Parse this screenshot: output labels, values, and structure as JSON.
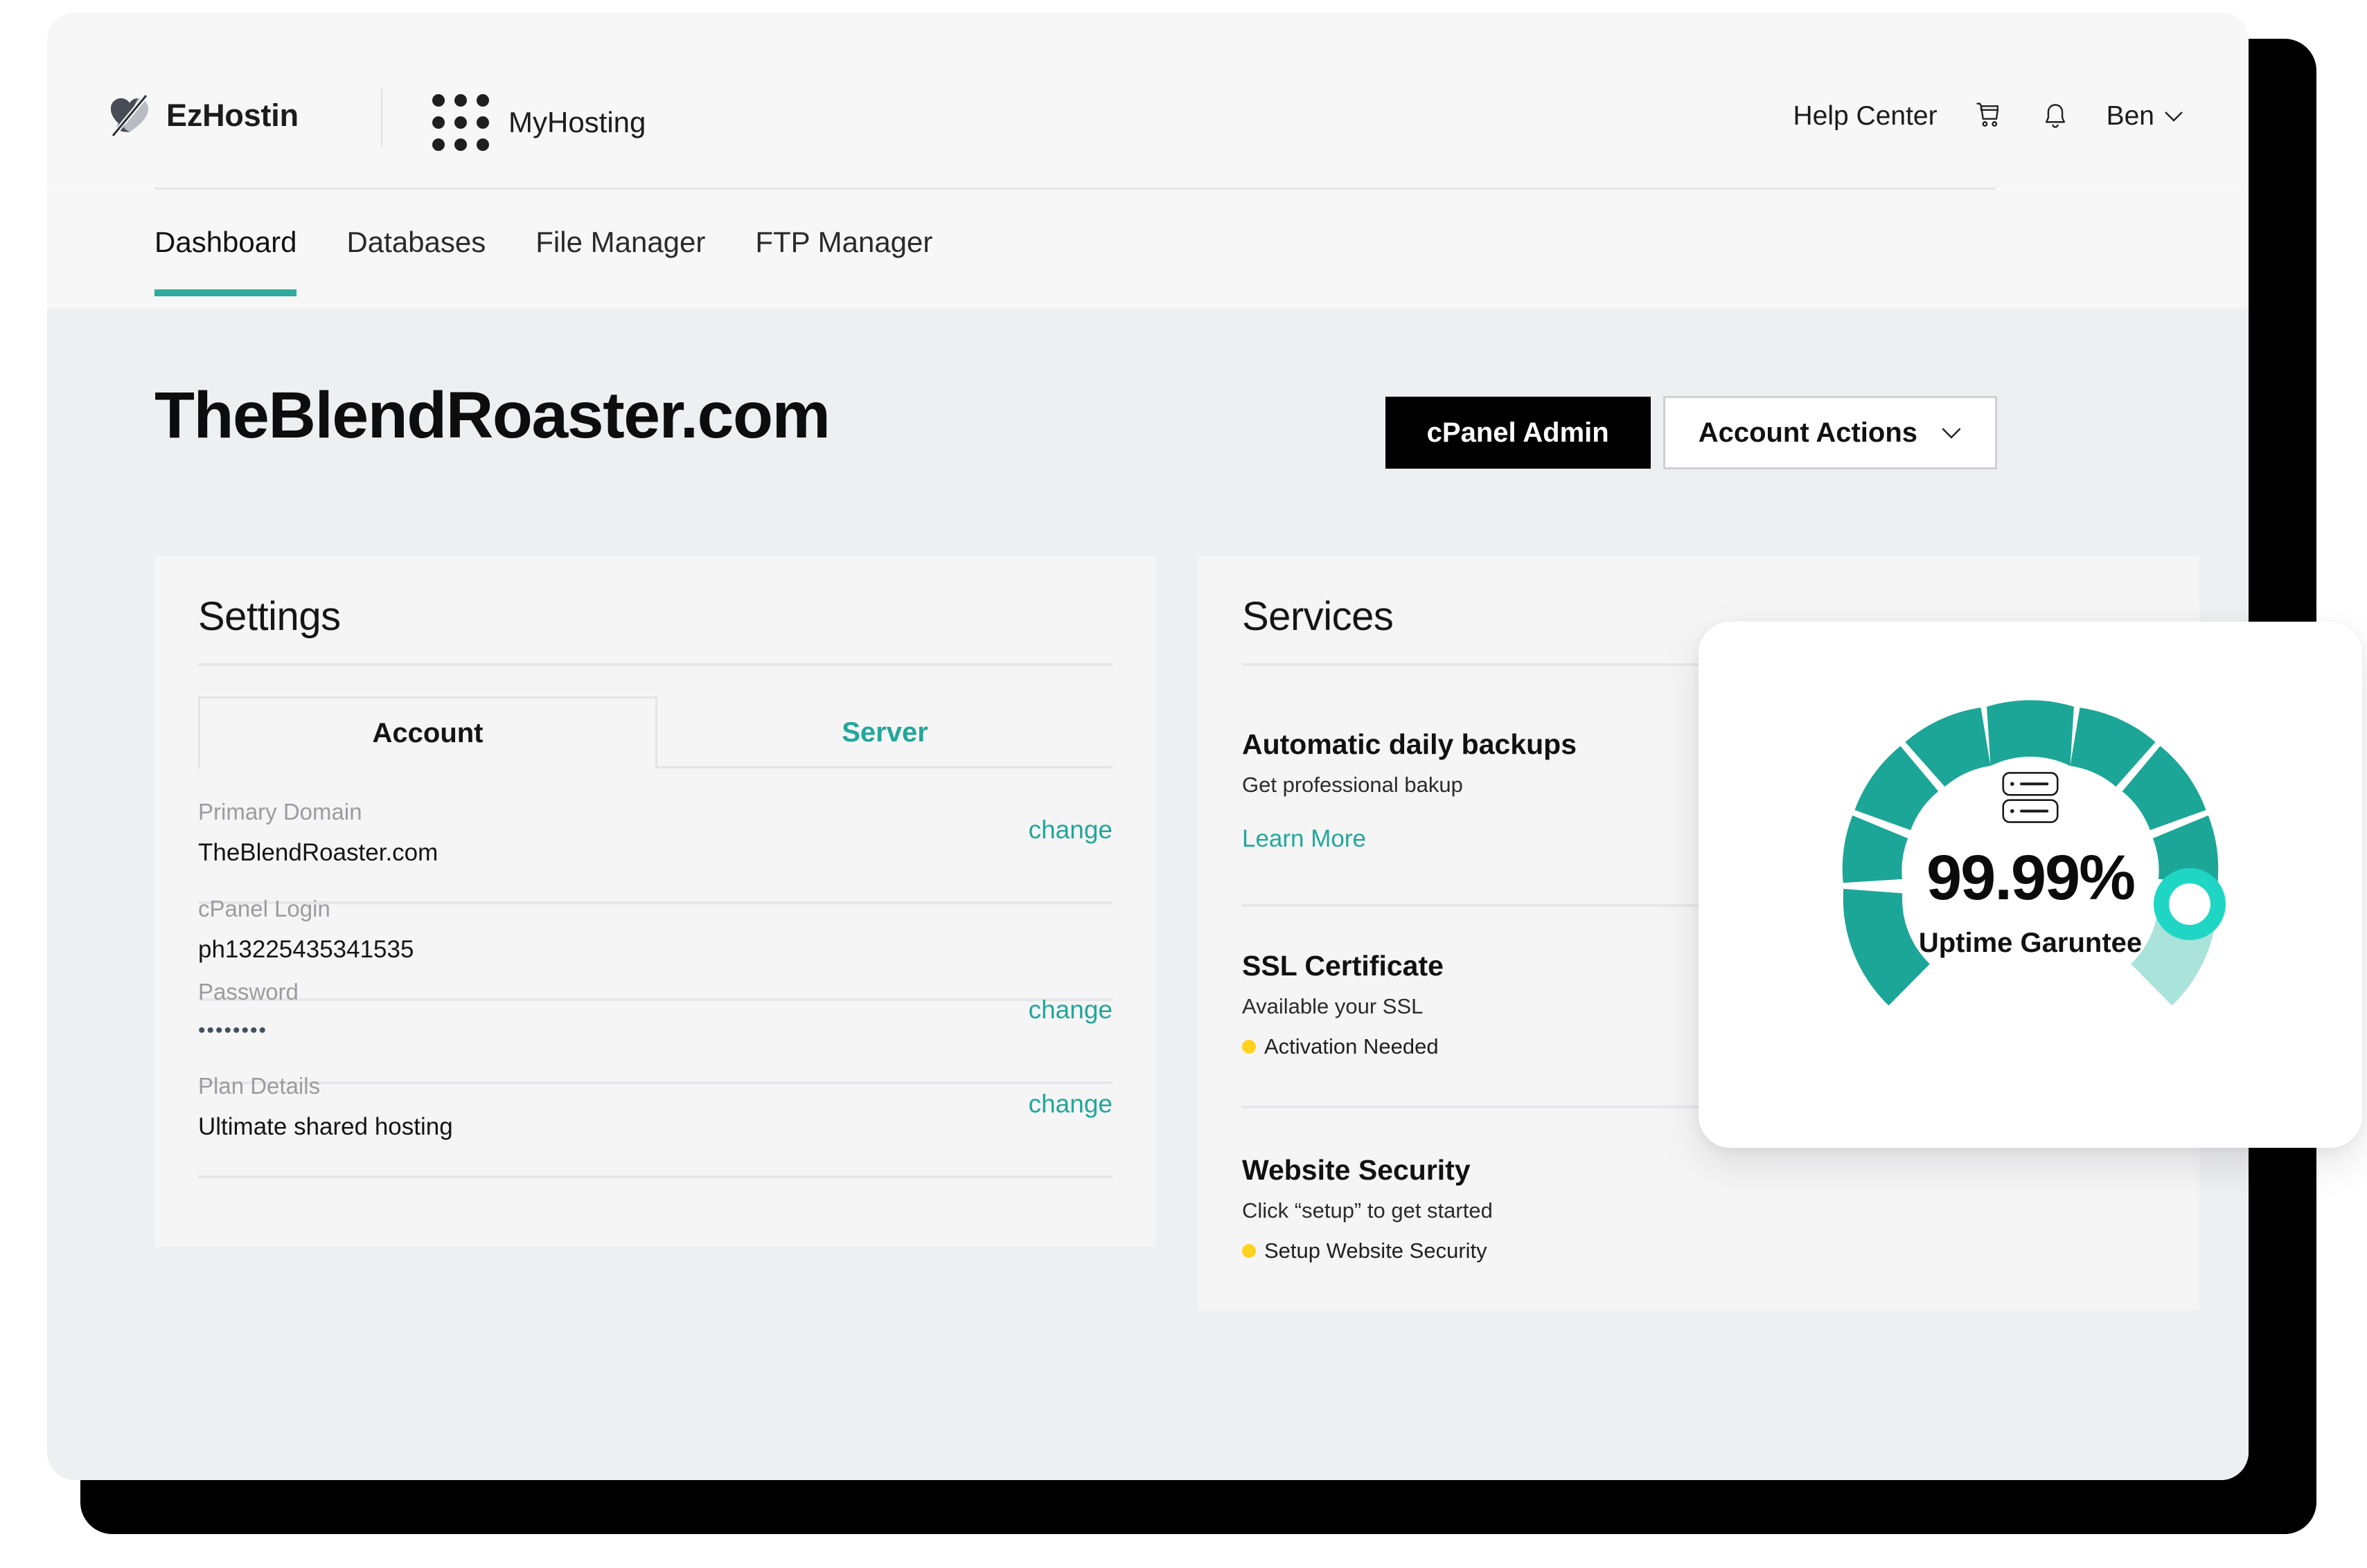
{
  "header": {
    "brand_name": "EzHostin",
    "logo_icon": "leaf-heart-logo",
    "app_switcher_icon": "grid-dots-icon",
    "app_switcher_label": "MyHosting",
    "help_link": "Help Center",
    "cart_icon": "shopping-cart-icon",
    "bell_icon": "notification-bell-icon",
    "user_name": "Ben",
    "user_chevron_icon": "chevron-down-icon"
  },
  "nav": {
    "tabs": [
      {
        "label": "Dashboard",
        "active": true
      },
      {
        "label": "Databases",
        "active": false
      },
      {
        "label": "File Manager",
        "active": false
      },
      {
        "label": "FTP Manager",
        "active": false
      }
    ],
    "active_underline_color": "#2faa9e"
  },
  "page": {
    "title": "TheBlendRoaster.com",
    "primary_button": "cPanel Admin",
    "secondary_button": "Account Actions",
    "secondary_button_icon": "chevron-down-icon"
  },
  "settings_card": {
    "title": "Settings",
    "tabs": [
      {
        "label": "Account",
        "active": true
      },
      {
        "label": "Server",
        "active": false
      }
    ],
    "rows": [
      {
        "label": "Primary Domain",
        "value": "TheBlendRoaster.com",
        "action": "change",
        "has_action": true
      },
      {
        "label": "cPanel Login",
        "value": "ph13225435341535",
        "action": "",
        "has_action": false
      },
      {
        "label": "Password",
        "value": "••••••••",
        "action": "change",
        "has_action": true
      },
      {
        "label": "Plan Details",
        "value": "Ultimate shared hosting",
        "action": "change",
        "has_action": true
      }
    ]
  },
  "services_card": {
    "title": "Services",
    "items": [
      {
        "title": "Automatic daily backups",
        "subtitle": "Get professional bakup",
        "link": "Learn More",
        "status": "",
        "has_status": false
      },
      {
        "title": "SSL Certificate",
        "subtitle": "Available your SSL",
        "link": "",
        "status": "Activation Needed",
        "has_status": true
      },
      {
        "title": "Website Security",
        "subtitle": "Click “setup” to get started",
        "link": "",
        "status": "Setup Website Security",
        "has_status": true
      }
    ],
    "status_dot_color": "#ffd21e"
  },
  "uptime_widget": {
    "value": "99.99%",
    "caption": "Uptime  Garuntee",
    "icon": "server-rack-icon",
    "filled_color": "#1ca697",
    "track_color": "#a9e3da",
    "marker_color": "#1fd6c4"
  },
  "colors": {
    "accent_teal": "#22a79a",
    "gauge_teal": "#1ca697",
    "status_yellow": "#ffd21e",
    "topbar_bg": "#f7f7f7",
    "page_bg": "#eeeff1",
    "card_bg": "#f5f5f6"
  }
}
